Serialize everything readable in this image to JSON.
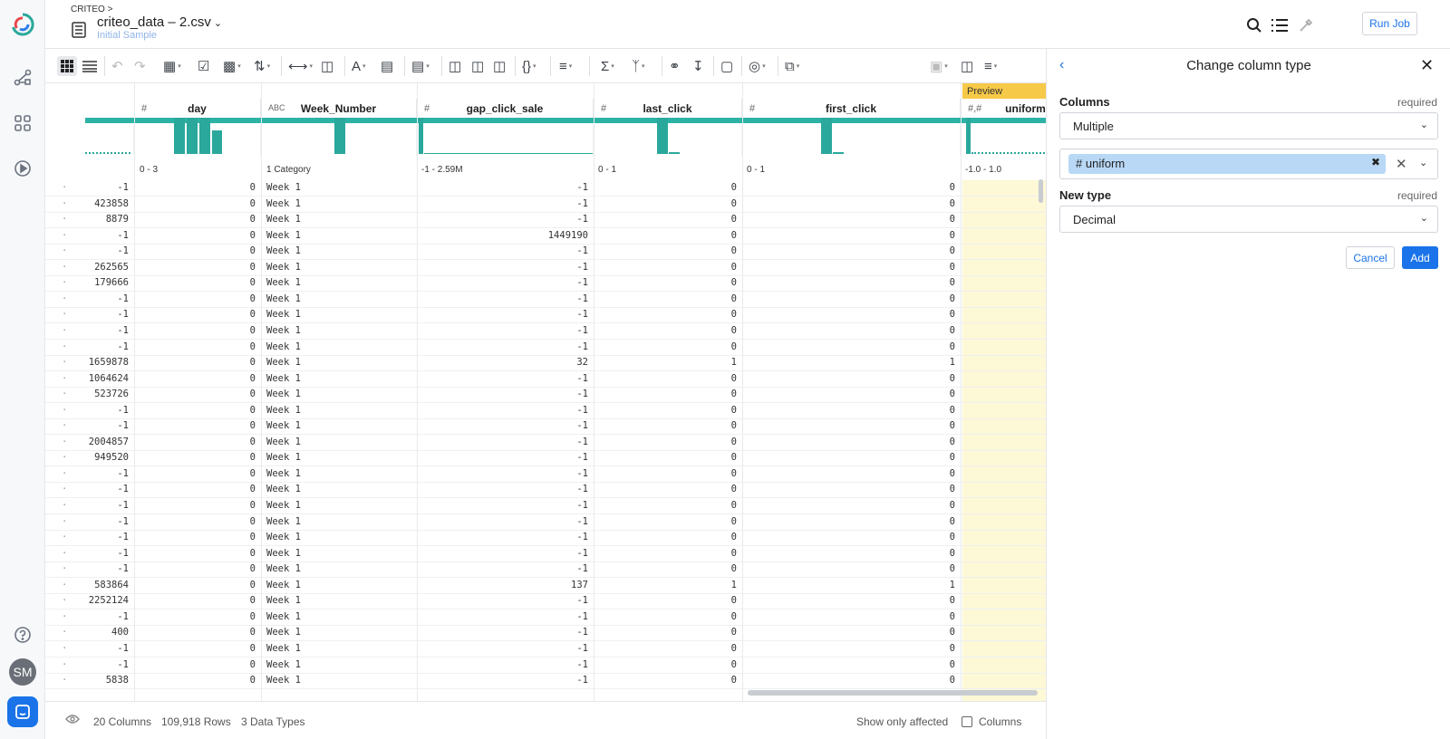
{
  "header": {
    "breadcrumb": "CRITEO",
    "breadcrumb_sep": ">",
    "title": "criteo_data – 2.csv",
    "subtitle": "Initial Sample",
    "run_job": "Run Job"
  },
  "nav": {
    "avatar": "SM",
    "icons": [
      "logo-icon",
      "flow-icon",
      "library-icon",
      "jobs-icon",
      "help-icon"
    ]
  },
  "grid": {
    "preview_tag": "Preview",
    "columns": [
      {
        "name": "day",
        "type_icon": "#",
        "range": "0 - 3"
      },
      {
        "name": "Week_Number",
        "type_icon": "ABC",
        "range": "1 Category"
      },
      {
        "name": "gap_click_sale",
        "type_icon": "#",
        "range": "-1 - 2.59M"
      },
      {
        "name": "last_click",
        "type_icon": "#",
        "range": "0 - 1"
      },
      {
        "name": "first_click",
        "type_icon": "#",
        "range": "0 - 1"
      },
      {
        "name": "uniform",
        "type_icon": "#,#",
        "range": "-1.0 - 1.0"
      }
    ],
    "rows": [
      [
        "-1",
        "0",
        "Week 1",
        "-1",
        "0",
        "0",
        "-1"
      ],
      [
        "423858",
        "0",
        "Week 1",
        "-1",
        "0",
        "0",
        "-1"
      ],
      [
        "8879",
        "0",
        "Week 1",
        "-1",
        "0",
        "0",
        "-1"
      ],
      [
        "-1",
        "0",
        "Week 1",
        "1449190",
        "0",
        "0",
        "-1"
      ],
      [
        "-1",
        "0",
        "Week 1",
        "-1",
        "0",
        "0",
        "-1"
      ],
      [
        "262565",
        "0",
        "Week 1",
        "-1",
        "0",
        "0",
        "-1"
      ],
      [
        "179666",
        "0",
        "Week 1",
        "-1",
        "0",
        "0",
        "-1"
      ],
      [
        "-1",
        "0",
        "Week 1",
        "-1",
        "0",
        "0",
        "-1"
      ],
      [
        "-1",
        "0",
        "Week 1",
        "-1",
        "0",
        "0",
        "-1"
      ],
      [
        "-1",
        "0",
        "Week 1",
        "-1",
        "0",
        "0",
        "-1"
      ],
      [
        "-1",
        "0",
        "Week 1",
        "-1",
        "0",
        "0",
        "-1"
      ],
      [
        "1659878",
        "0",
        "Week 1",
        "32",
        "1",
        "1",
        "1"
      ],
      [
        "1064624",
        "0",
        "Week 1",
        "-1",
        "0",
        "0",
        "-1"
      ],
      [
        "523726",
        "0",
        "Week 1",
        "-1",
        "0",
        "0",
        "-1"
      ],
      [
        "-1",
        "0",
        "Week 1",
        "-1",
        "0",
        "0",
        "-1"
      ],
      [
        "-1",
        "0",
        "Week 1",
        "-1",
        "0",
        "0",
        "-1"
      ],
      [
        "2004857",
        "0",
        "Week 1",
        "-1",
        "0",
        "0",
        "-1"
      ],
      [
        "949520",
        "0",
        "Week 1",
        "-1",
        "0",
        "0",
        "-1"
      ],
      [
        "-1",
        "0",
        "Week 1",
        "-1",
        "0",
        "0",
        "-1"
      ],
      [
        "-1",
        "0",
        "Week 1",
        "-1",
        "0",
        "0",
        "-1"
      ],
      [
        "-1",
        "0",
        "Week 1",
        "-1",
        "0",
        "0",
        "-1"
      ],
      [
        "-1",
        "0",
        "Week 1",
        "-1",
        "0",
        "0",
        "-1"
      ],
      [
        "-1",
        "0",
        "Week 1",
        "-1",
        "0",
        "0",
        "-1"
      ],
      [
        "-1",
        "0",
        "Week 1",
        "-1",
        "0",
        "0",
        "-1"
      ],
      [
        "-1",
        "0",
        "Week 1",
        "-1",
        "0",
        "0",
        "-1"
      ],
      [
        "583864",
        "0",
        "Week 1",
        "137",
        "1",
        "1",
        "1"
      ],
      [
        "2252124",
        "0",
        "Week 1",
        "-1",
        "0",
        "0",
        "-1"
      ],
      [
        "-1",
        "0",
        "Week 1",
        "-1",
        "0",
        "0",
        "-1"
      ],
      [
        "400",
        "0",
        "Week 1",
        "-1",
        "0",
        "0",
        "-1"
      ],
      [
        "-1",
        "0",
        "Week 1",
        "-1",
        "0",
        "0",
        "-1"
      ],
      [
        "-1",
        "0",
        "Week 1",
        "-1",
        "0",
        "0",
        "-1"
      ],
      [
        "5838",
        "0",
        "Week 1",
        "-1",
        "0",
        "0",
        "-1"
      ]
    ]
  },
  "footer": {
    "columns": "20 Columns",
    "rows": "109,918 Rows",
    "types": "3 Data Types",
    "show_affected": "Show only affected",
    "columns_toggle": "Columns"
  },
  "panel": {
    "title": "Change column type",
    "columns_label": "Columns",
    "required": "required",
    "columns_mode": "Multiple",
    "selected_tag": "uniform",
    "selected_tag_icon": "#",
    "new_type_label": "New type",
    "new_type_value": "Decimal",
    "cancel": "Cancel",
    "add": "Add"
  },
  "colors": {
    "accent": "#1a73e8",
    "histogram": "#2aa89b",
    "preview": "#f7c948",
    "preview_bg": "#fdf8d6"
  }
}
